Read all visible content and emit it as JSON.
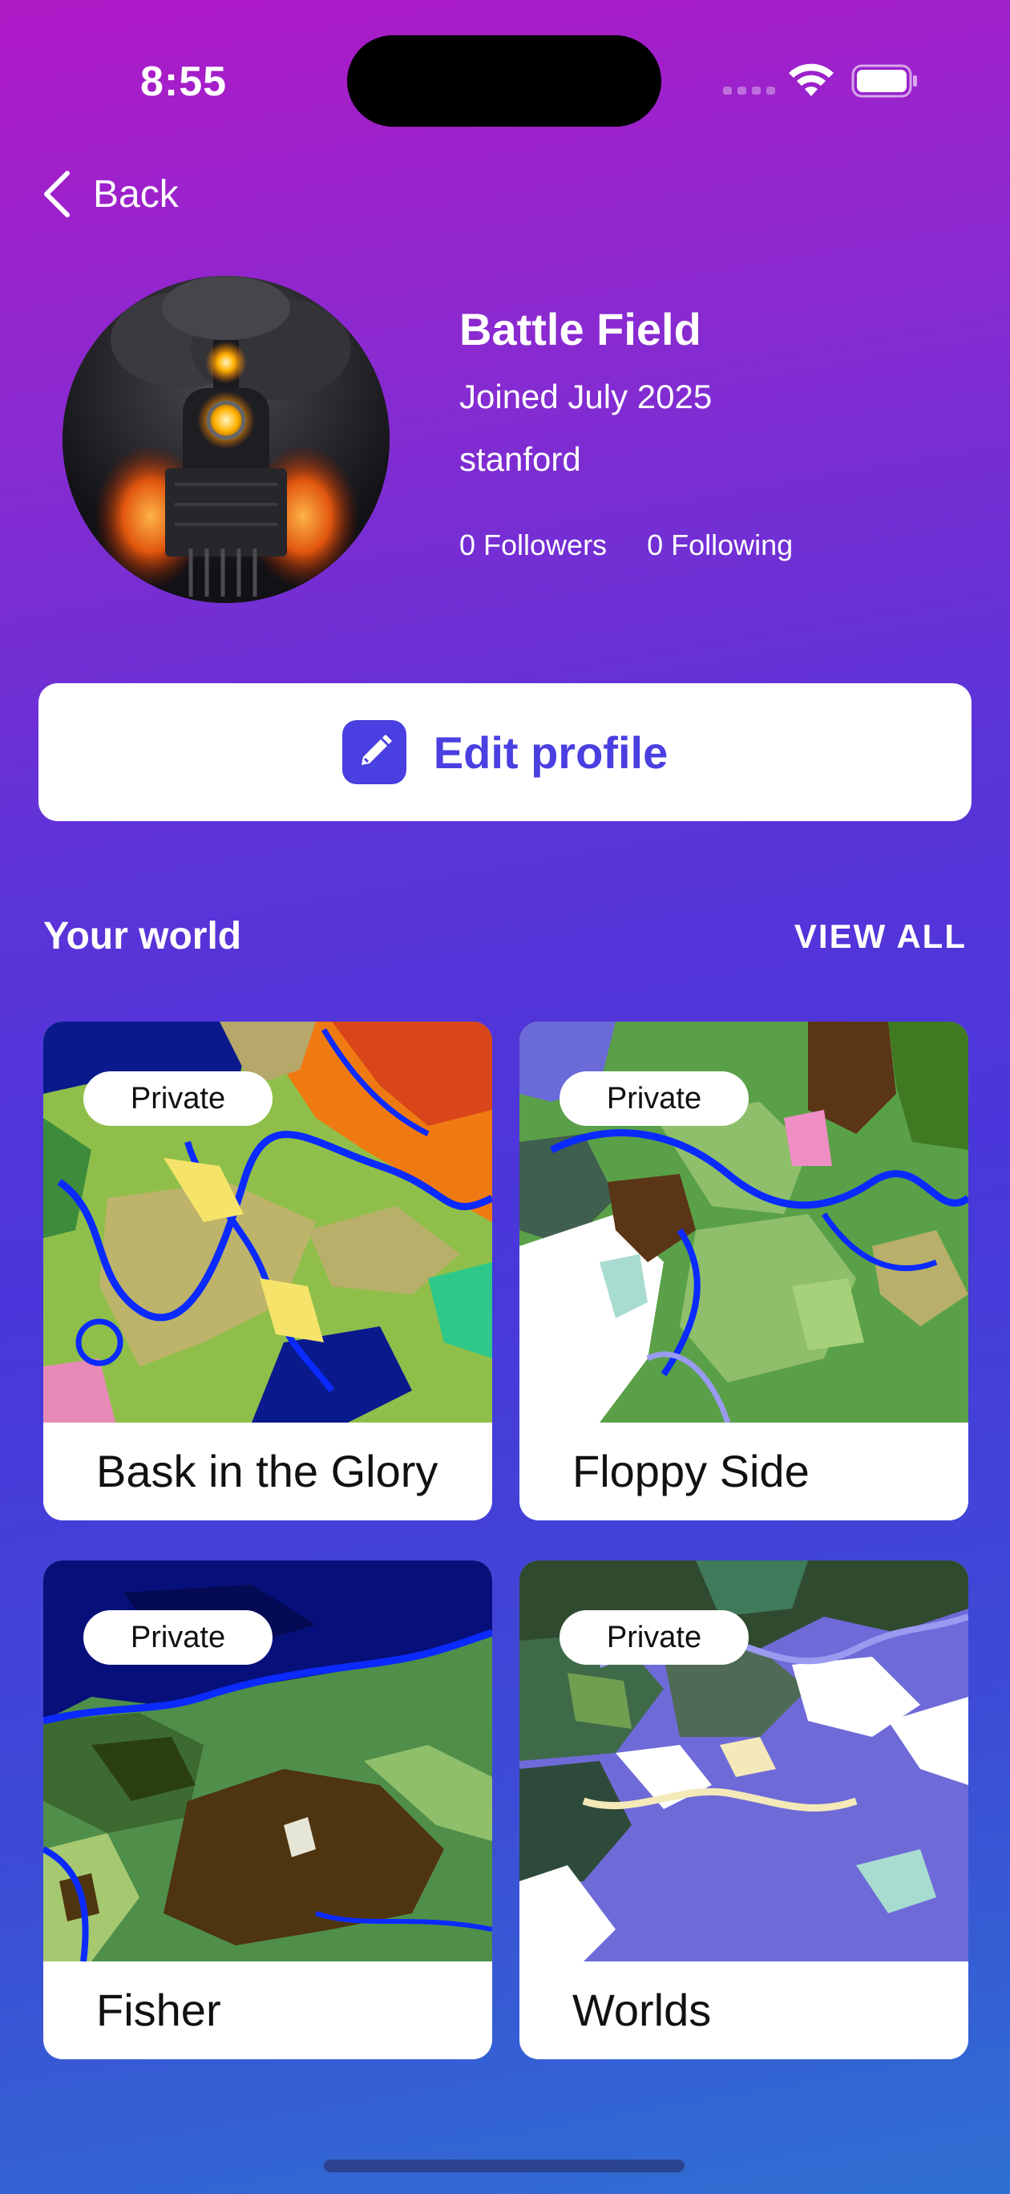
{
  "status_bar": {
    "time": "8:55"
  },
  "nav": {
    "back_label": "Back"
  },
  "profile": {
    "name": "Battle Field",
    "joined": "Joined July 2025",
    "school": "stanford",
    "followers": "0 Followers",
    "following": "0 Following"
  },
  "edit_button": {
    "label": "Edit profile"
  },
  "section": {
    "title": "Your world",
    "view_all": "VIEW ALL"
  },
  "worlds": [
    {
      "title": "Bask in the Glory",
      "badge": "Private"
    },
    {
      "title": "Floppy Side",
      "badge": "Private"
    },
    {
      "title": "Fisher",
      "badge": "Private"
    },
    {
      "title": "Worlds",
      "badge": "Private"
    }
  ],
  "colors": {
    "accent": "#4a3fe0",
    "gradient_top": "#b019c6",
    "gradient_bottom": "#2f6fd2"
  }
}
